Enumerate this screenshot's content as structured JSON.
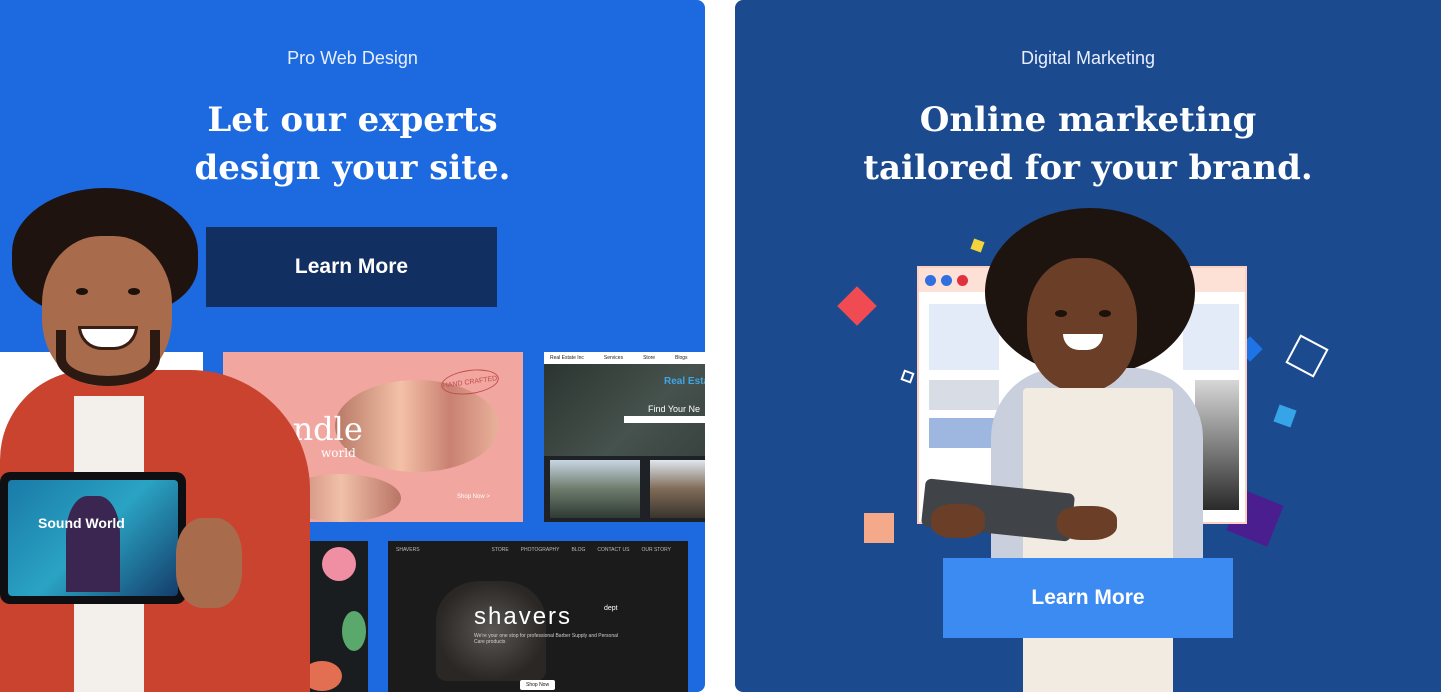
{
  "left_card": {
    "eyebrow": "Pro Web Design",
    "headline_line1": "Let our experts",
    "headline_line2": "design your site.",
    "cta_label": "Learn More",
    "templates": {
      "candle_brand": "Candle",
      "candle_sub": "world",
      "candle_stamp": "HAND CRAFTED",
      "candle_shop": "Shop Now >",
      "realestate_nav": [
        "Real Estate Inc",
        "Services",
        "Store",
        "Blogs"
      ],
      "realestate_title": "Real Estate",
      "realestate_find": "Find Your Ne",
      "shavers_nav": [
        "SHAVERS",
        "STORE",
        "PHOTOGRAPHY",
        "BLOG",
        "CONTACT US",
        "OUR STORY"
      ],
      "shavers_word": "shavers",
      "shavers_dept": "dept",
      "shavers_sub": "We're your one stop for professional Barber Supply and Personal Care products",
      "shavers_shop": "Shop Now",
      "tablet_app": "Sound World"
    }
  },
  "right_card": {
    "eyebrow": "Digital Marketing",
    "headline_line1": "Online marketing",
    "headline_line2": "tailored for your brand.",
    "cta_label": "Learn More"
  },
  "colors": {
    "left_bg": "#1d6ae0",
    "right_bg": "#1c4a8f",
    "left_button": "#122f61",
    "right_button": "#3b8bf2"
  }
}
